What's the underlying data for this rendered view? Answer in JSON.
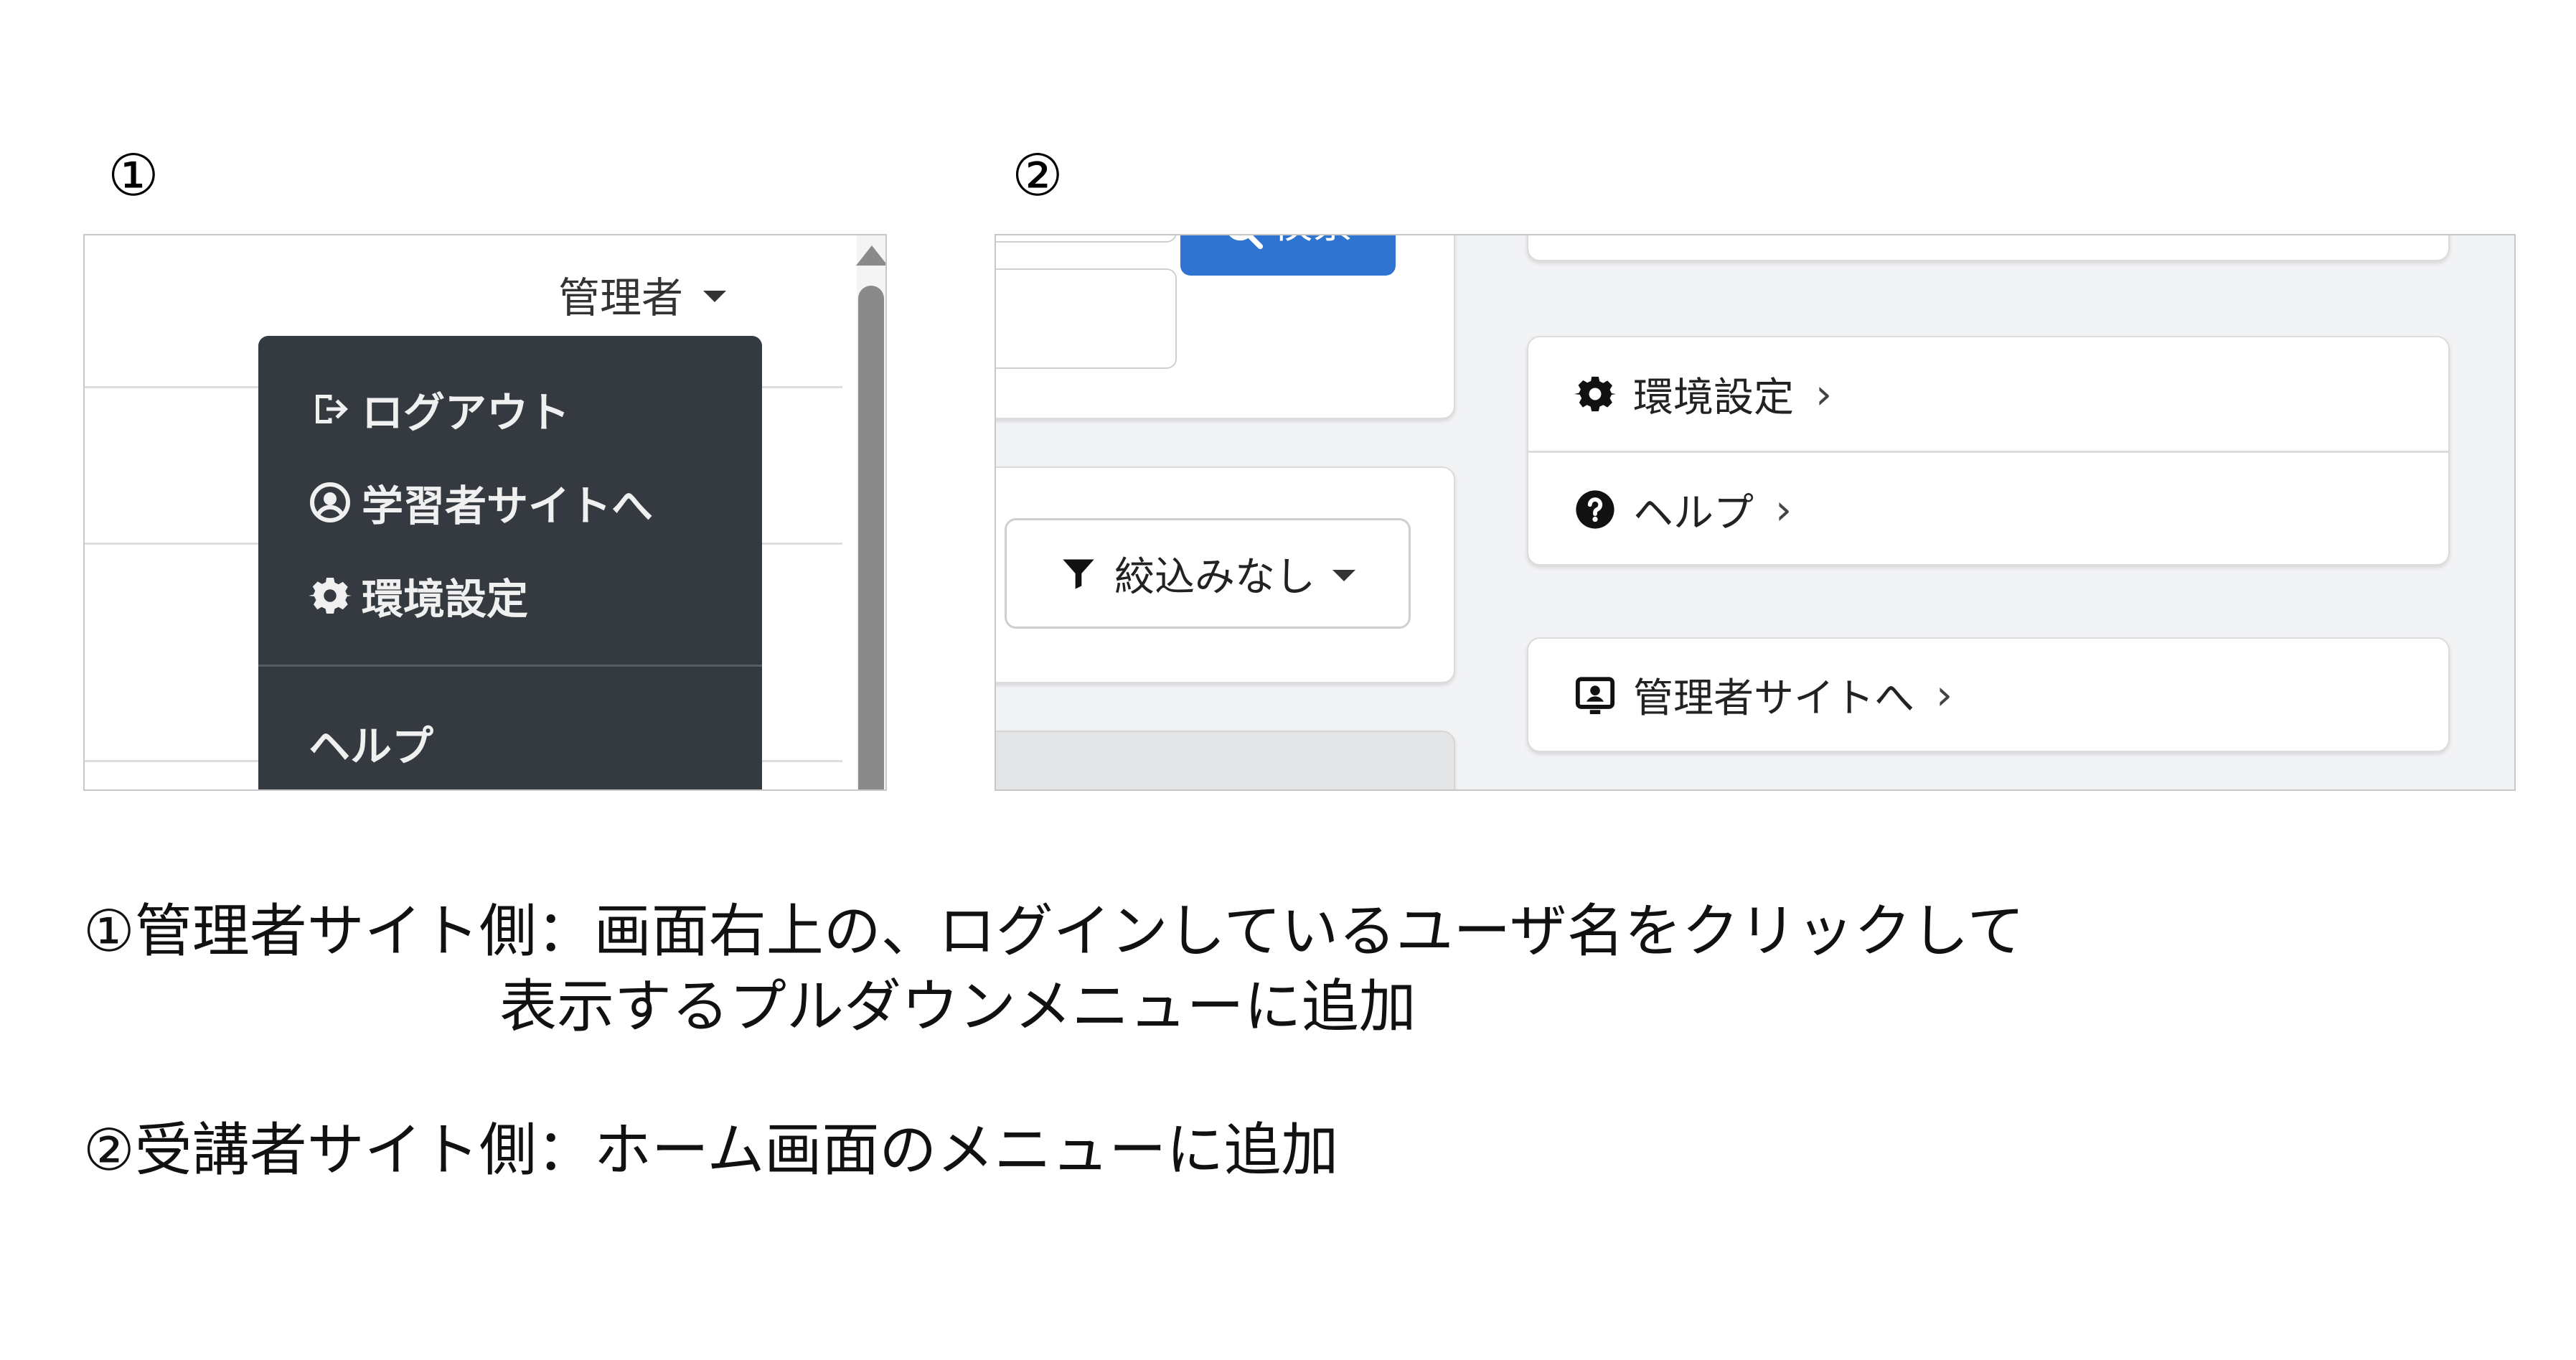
{
  "panel1": {
    "marker": "①",
    "admin_user": "管理者",
    "dropdown": {
      "items": [
        {
          "icon": "logout-icon",
          "label": "ログアウト"
        },
        {
          "icon": "user-circle-icon",
          "label": "学習者サイトへ"
        },
        {
          "icon": "gear-icon",
          "label": "環境設定"
        }
      ],
      "help_label": "ヘルプ"
    }
  },
  "panel2": {
    "marker": "②",
    "search_label": "検索",
    "filter_label": "絞込みなし",
    "menu": {
      "settings_label": "環境設定",
      "help_label": "ヘルプ",
      "admin_site_label": "管理者サイトへ",
      "chevron": "›"
    }
  },
  "captions": {
    "line1": "①管理者サイト側：画面右上の、ログインしているユーザ名をクリックして",
    "line2": "表示するプルダウンメニューに追加",
    "line3": "②受講者サイト側：ホーム画面のメニューに追加"
  },
  "colors": {
    "dropdown_bg": "#343a40",
    "search_button": "#2f74d0"
  }
}
